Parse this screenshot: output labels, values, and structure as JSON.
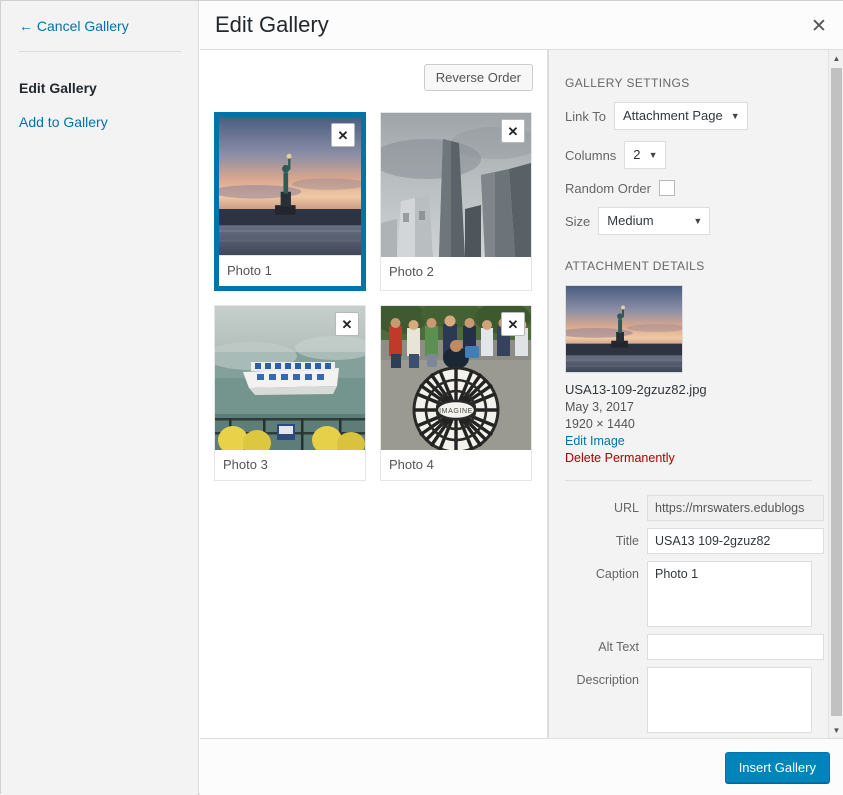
{
  "menu": {
    "cancel_label": "← Cancel Gallery",
    "items": [
      {
        "label": "Edit Gallery",
        "active": true
      },
      {
        "label": "Add to Gallery",
        "active": false
      }
    ]
  },
  "header": {
    "title": "Edit Gallery",
    "close_icon": "close-icon"
  },
  "toolbar": {
    "reverse_order_label": "Reverse Order"
  },
  "gallery": {
    "items": [
      {
        "caption": "Photo 1",
        "selected": true,
        "remove_icon": "remove-icon"
      },
      {
        "caption": "Photo 2",
        "selected": false,
        "remove_icon": "remove-icon"
      },
      {
        "caption": "Photo 3",
        "selected": false,
        "remove_icon": "remove-icon"
      },
      {
        "caption": "Photo 4",
        "selected": false,
        "remove_icon": "remove-icon"
      }
    ]
  },
  "gallery_settings": {
    "heading": "GALLERY SETTINGS",
    "link_to": {
      "label": "Link To",
      "value": "Attachment Page"
    },
    "columns": {
      "label": "Columns",
      "value": "2"
    },
    "random_order": {
      "label": "Random Order",
      "checked": false
    },
    "size": {
      "label": "Size",
      "value": "Medium"
    }
  },
  "attachment_details": {
    "heading": "ATTACHMENT DETAILS",
    "filename": "USA13-109-2gzuz82.jpg",
    "date": "May 3, 2017",
    "dimensions": "1920 × 1440",
    "edit_image_label": "Edit Image",
    "delete_label": "Delete Permanently",
    "fields": {
      "url": {
        "label": "URL",
        "value": "https://mrswaters.edublogs"
      },
      "title": {
        "label": "Title",
        "value": "USA13 109-2gzuz82"
      },
      "caption": {
        "label": "Caption",
        "value": "Photo 1"
      },
      "alt_text": {
        "label": "Alt Text",
        "value": ""
      },
      "description": {
        "label": "Description",
        "value": ""
      }
    }
  },
  "footer": {
    "insert_label": "Insert Gallery"
  },
  "colors": {
    "accent": "#0073aa",
    "primary_button": "#0085ba",
    "delete": "#a00"
  }
}
